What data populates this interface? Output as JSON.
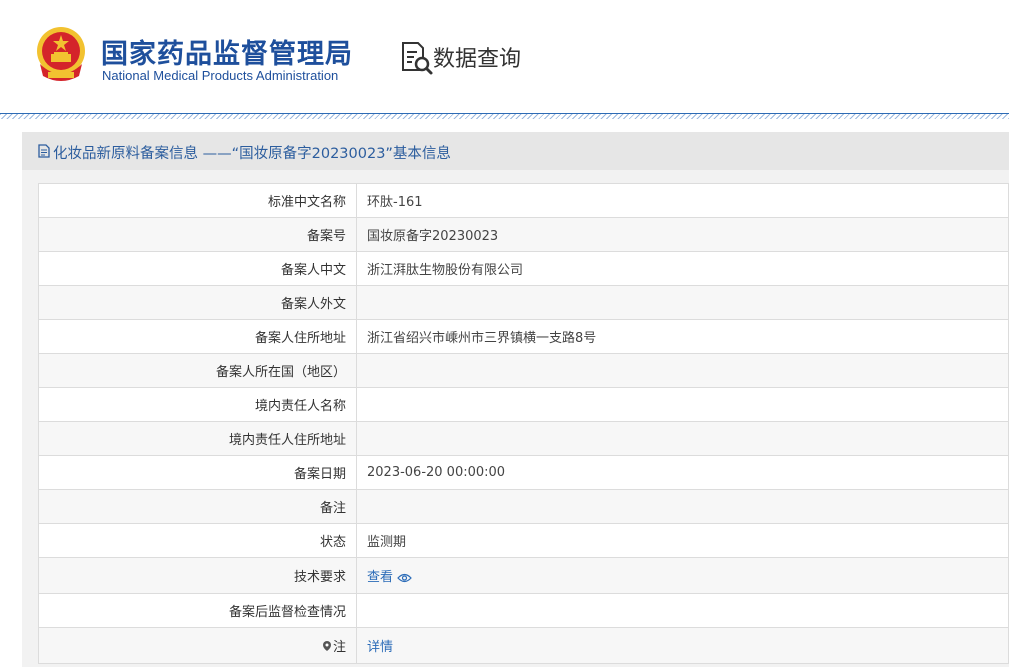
{
  "header": {
    "logo_cn": "国家药品监督管理局",
    "logo_en": "National Medical Products Administration",
    "query_title": "数据查询",
    "icons": {
      "emblem": "national-emblem-icon",
      "query": "document-search-icon"
    }
  },
  "panel": {
    "title": "化妆品新原料备案信息 ——“国妆原备字20230023”基本信息",
    "icon": "document-icon"
  },
  "rows": [
    {
      "label": "标准中文名称",
      "value": "环肽-161"
    },
    {
      "label": "备案号",
      "value": "国妆原备字20230023"
    },
    {
      "label": "备案人中文",
      "value": "浙江湃肽生物股份有限公司"
    },
    {
      "label": "备案人外文",
      "value": ""
    },
    {
      "label": "备案人住所地址",
      "value": "浙江省绍兴市嵊州市三界镇横一支路8号"
    },
    {
      "label": "备案人所在国（地区）",
      "value": ""
    },
    {
      "label": "境内责任人名称",
      "value": ""
    },
    {
      "label": "境内责任人住所地址",
      "value": ""
    },
    {
      "label": "备案日期",
      "value": "2023-06-20 00:00:00"
    },
    {
      "label": "备注",
      "value": ""
    },
    {
      "label": "状态",
      "value": "监测期"
    },
    {
      "label": "技术要求",
      "value": "查看",
      "icon": "eye-icon"
    },
    {
      "label": "备案后监督检查情况",
      "value": ""
    },
    {
      "label": "注",
      "value": "详情",
      "icon": "pin-icon"
    }
  ],
  "colors": {
    "brand_blue": "#1e4f9c",
    "link_blue": "#2c6cb8",
    "emblem_red": "#d4242a",
    "emblem_gold": "#f2c230"
  }
}
